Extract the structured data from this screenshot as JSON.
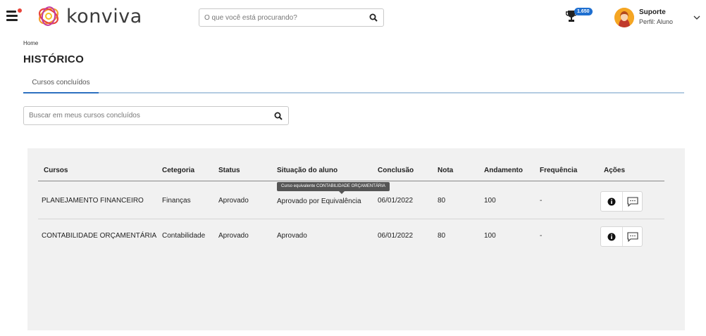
{
  "header": {
    "logo_text": "konviva",
    "search_placeholder": "O que você está procurando?",
    "points_badge": "1.650",
    "user_name": "Suporte",
    "user_profile": "Perfil: Aluno"
  },
  "breadcrumb": "Home",
  "page_title": "HISTÓRICO",
  "tabs": [
    {
      "label": "Cursos concluídos",
      "active": true
    }
  ],
  "course_search_placeholder": "Buscar em meus cursos concluídos",
  "table": {
    "headers": {
      "course": "Cursos",
      "category": "Cetegoria",
      "status": "Status",
      "situation": "Situação do aluno",
      "conclusion": "Conclusão",
      "grade": "Nota",
      "progress": "Andamento",
      "frequency": "Frequência",
      "actions": "Ações"
    },
    "rows": [
      {
        "course": "PLANEJAMENTO FINANCEIRO",
        "category": "Finanças",
        "status": "Aprovado",
        "situation": "Aprovado por Equivalência",
        "conclusion": "06/01/2022",
        "grade": "80",
        "progress": "100",
        "frequency": "-"
      },
      {
        "course": "CONTABILIDADE ORÇAMENTÁRIA",
        "category": "Contabilidade",
        "status": "Aprovado",
        "situation": "Aprovado",
        "conclusion": "06/01/2022",
        "grade": "80",
        "progress": "100",
        "frequency": "-"
      }
    ],
    "tooltip": "Curso equivalente CONTABILIDADE ORÇAMENTÁRIA"
  },
  "icons": {
    "menu": "hamburger-menu-icon",
    "search": "search-icon",
    "trophy": "trophy-icon",
    "chevron": "chevron-down-icon",
    "info": "info-icon",
    "chat": "chat-icon"
  },
  "colors": {
    "accent": "#2d70c0",
    "badge": "#1e6fd0",
    "notification_dot": "#e8443a",
    "panel_bg": "#f1f1f1"
  }
}
